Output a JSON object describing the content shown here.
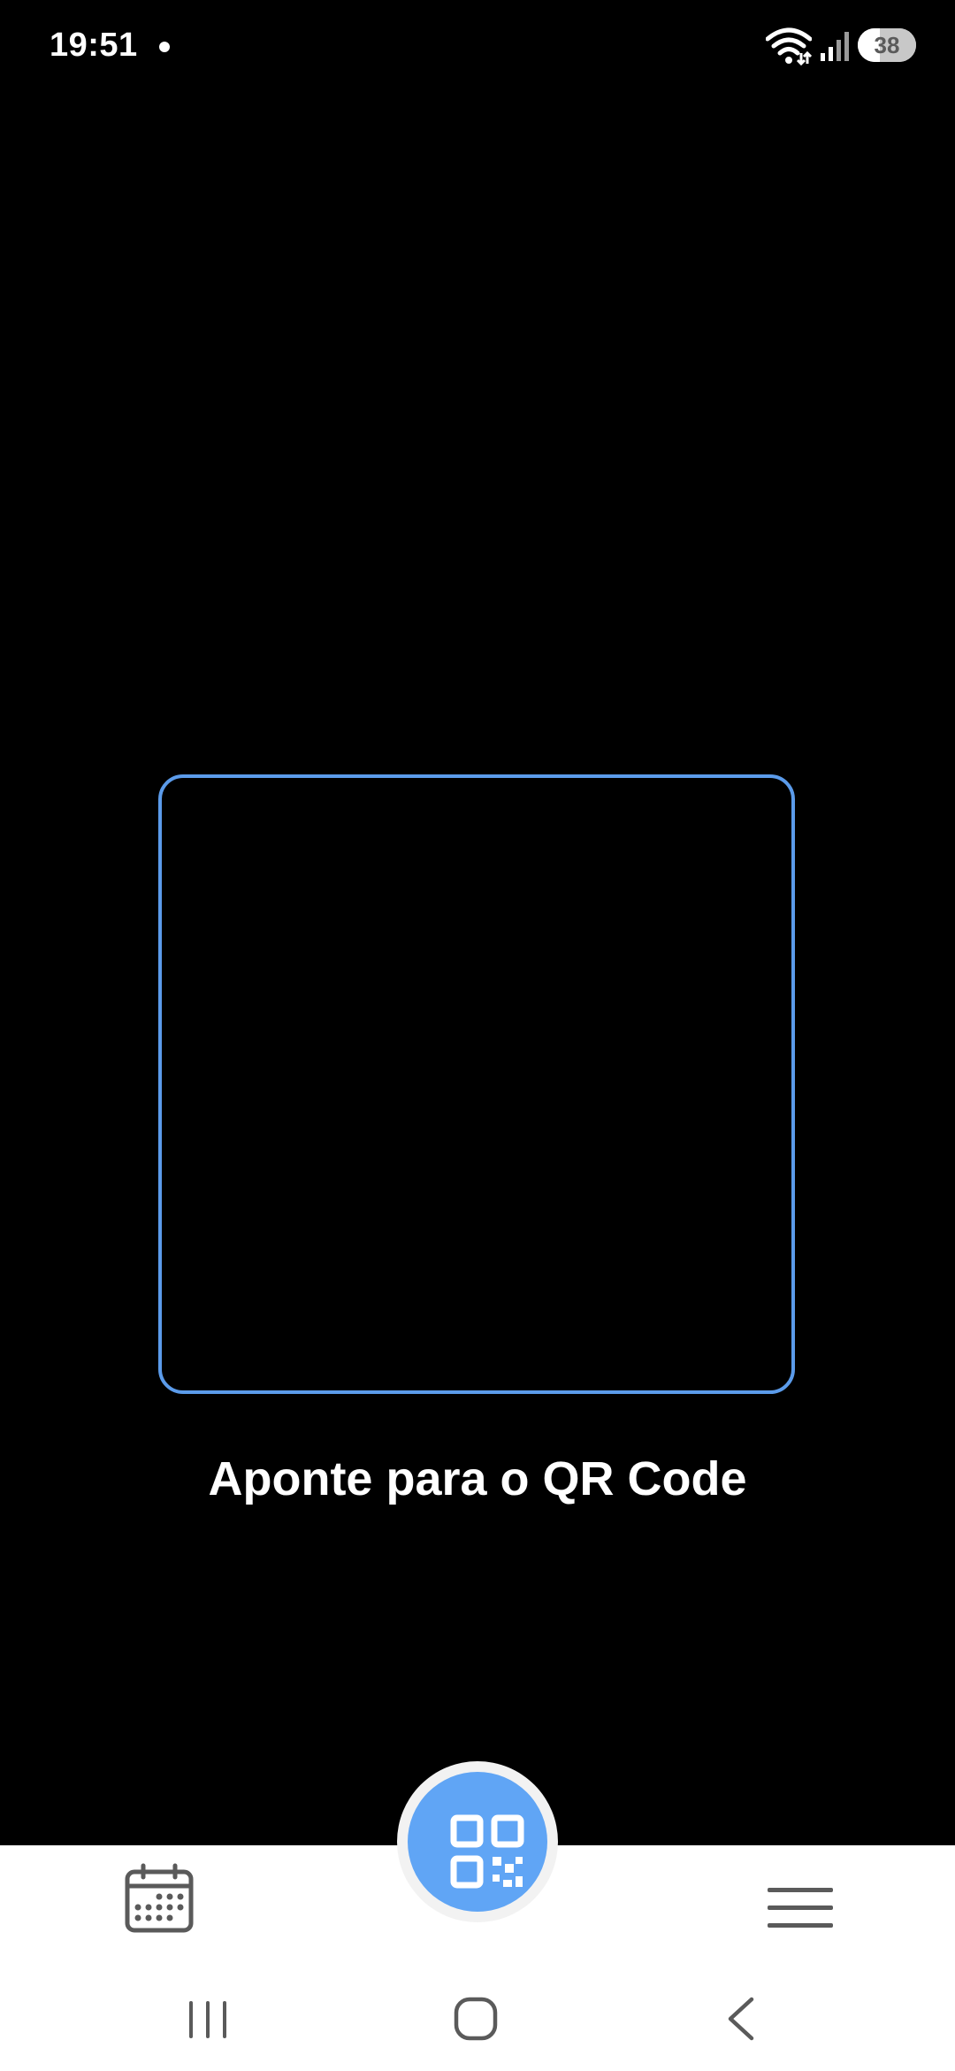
{
  "status_bar": {
    "time": "19:51",
    "battery_level": "38",
    "battery_fraction": 0.38,
    "icons": [
      "notification-dot",
      "wifi-icon",
      "signal-icon",
      "battery-icon"
    ]
  },
  "scanner": {
    "hint": "Aponte para o QR Code",
    "frame_color": "#5b9bea"
  },
  "bottom_nav": {
    "items": [
      {
        "icon": "calendar-icon"
      },
      {
        "icon": "qr-code-icon",
        "accent": "#60a5f5"
      },
      {
        "icon": "menu-icon"
      }
    ]
  },
  "system_nav": {
    "buttons": [
      "recents-icon",
      "home-icon",
      "back-icon"
    ]
  }
}
